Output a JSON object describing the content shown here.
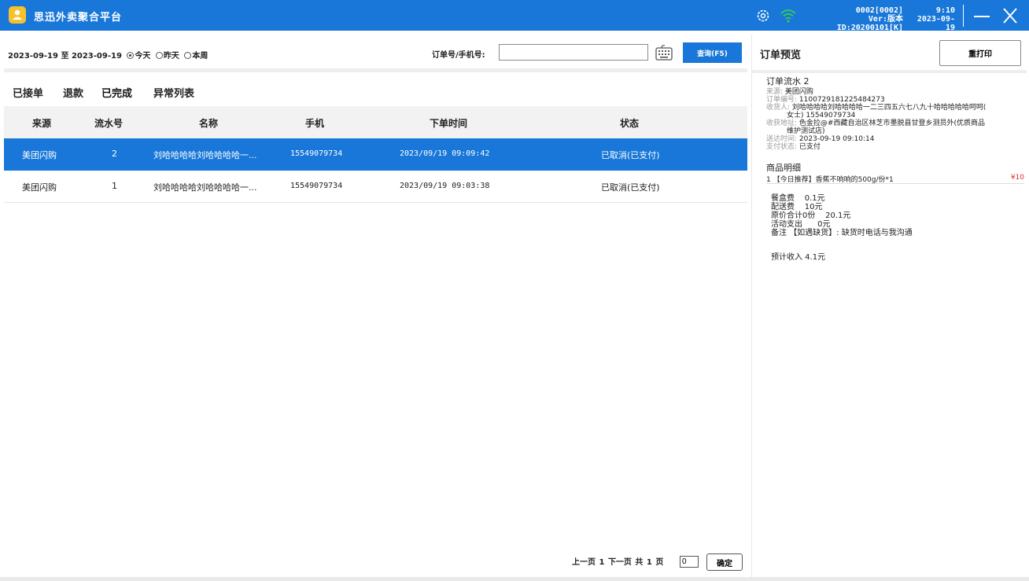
{
  "app": {
    "title": "思迅外卖聚合平台",
    "version_code": "0002[0002]",
    "version_id": "Ver:版本ID:20200101[K]",
    "clock_time": "9:10",
    "clock_date": "2023-09-19",
    "accent_color": "#1877d8"
  },
  "filter": {
    "date_from": "2023-09-19",
    "date_sep": "至",
    "date_to": "2023-09-19",
    "radios": [
      {
        "label": "今天",
        "checked": true
      },
      {
        "label": "昨天",
        "checked": false
      },
      {
        "label": "本周",
        "checked": false
      }
    ],
    "search_label": "订单号/手机号:",
    "search_value": "",
    "query_button": "查询(F5)"
  },
  "tabs": [
    {
      "label": "已接单"
    },
    {
      "label": "退款"
    },
    {
      "label": "已完成",
      "active": true
    },
    {
      "label": "异常列表"
    }
  ],
  "table": {
    "columns": [
      "来源",
      "流水号",
      "名称",
      "手机",
      "下单时间",
      "状态"
    ],
    "rows": [
      {
        "source": "美团闪购",
        "serial": "2",
        "name": "刘哈哈哈哈刘哈哈哈哈一...",
        "phone": "15549079734",
        "time": "2023/09/19 09:09:42",
        "status": "已取消(已支付)",
        "selected": true
      },
      {
        "source": "美团闪购",
        "serial": "1",
        "name": "刘哈哈哈哈刘哈哈哈哈一...",
        "phone": "15549079734",
        "time": "2023/09/19 09:03:38",
        "status": "已取消(已支付)",
        "selected": false
      }
    ]
  },
  "pager": {
    "prev": "上一页",
    "current": "1",
    "next": "下一页",
    "total_prefix": "共",
    "total_pages": "1",
    "total_suffix": "页",
    "input_value": "0",
    "ok": "确定"
  },
  "preview": {
    "title": "订单预览",
    "reprint": "重打印",
    "serial": "订单流水 2",
    "source_key": "来源:",
    "source_val": "美团闪购",
    "order_no_key": "订单编号:",
    "order_no_val": "1100729181225484273",
    "receiver_key": "收货人:",
    "receiver_val": "刘哈哈哈哈刘哈哈哈哈一二三四五六七八九十哈哈哈哈哈呵呵(",
    "receiver_val2": "女士) 15549079734",
    "address_key": "收获地址:",
    "address_val": "色金拉@#西藏自治区林芝市墨脱县甘登乡测员外(优质商品",
    "address_val2": "维护测试店)",
    "delivery_key": "送达时间:",
    "delivery_val": "2023-09-19 09:10:14",
    "pay_key": "支付状态:",
    "pay_val": "已支付",
    "goods_title": "商品明细",
    "goods": [
      {
        "qty": "1",
        "name": "【今日推荐】香蕉不响响的500g/份*1",
        "price": "¥10"
      }
    ],
    "fees": [
      {
        "label": "餐盒费",
        "value": "0.1元"
      },
      {
        "label": "配送费",
        "value": "10元"
      },
      {
        "label": "原价合计0份",
        "value": "20.1元"
      },
      {
        "label": "活动支出",
        "value": "0元"
      }
    ],
    "remark_label": "备注",
    "remark_value": "【如遇缺货】: 缺货时电话与我沟通",
    "income": "预计收入 4.1元"
  }
}
